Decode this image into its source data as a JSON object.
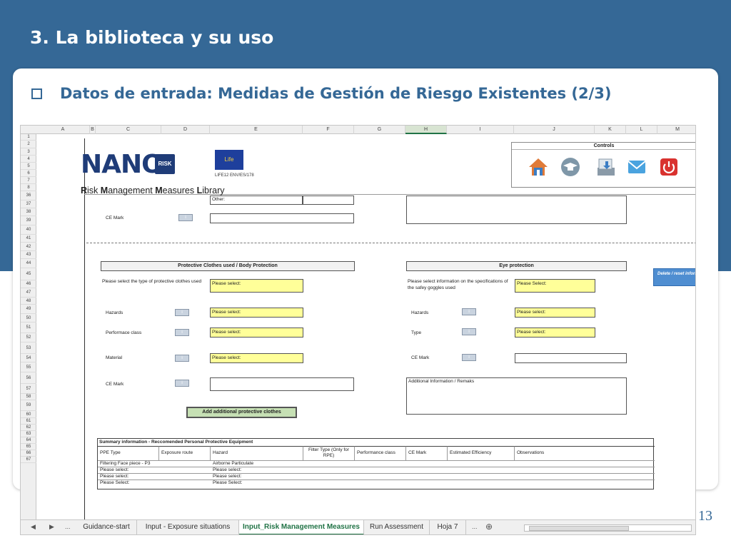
{
  "slide": {
    "title": "3. La biblioteca y su uso",
    "subtitle": "Datos de entrada: Medidas de Gestión de Riesgo Existentes (2/3)",
    "page_number": "13",
    "colors": {
      "band": "#356896",
      "accent": "#356896",
      "select_fill": "#ffff99",
      "excel_green": "#217346"
    }
  },
  "excel": {
    "columns": [
      "A",
      "B",
      "C",
      "D",
      "E",
      "F",
      "G",
      "H",
      "I",
      "J",
      "K",
      "L",
      "M"
    ],
    "active_column": "H",
    "rows": [
      "1",
      "2",
      "3",
      "4",
      "5",
      "6",
      "7",
      "8",
      "36",
      "37",
      "38",
      "39",
      "40",
      "41",
      "42",
      "43",
      "44",
      "45",
      "46",
      "47",
      "48",
      "49",
      "50",
      "51",
      "52",
      "53",
      "54",
      "55",
      "56",
      "57",
      "58",
      "59",
      "60",
      "61",
      "62",
      "63",
      "64",
      "65",
      "66",
      "67"
    ],
    "header": {
      "logo_text": "NANO",
      "logo_badge": "RISK",
      "eu_flag": "Life",
      "eu_code": "LIFE12 ENV/ES/178",
      "library_title_parts": [
        "R",
        "isk ",
        "M",
        "anagement ",
        "M",
        "easures ",
        "L",
        "ibrary"
      ]
    },
    "controls": {
      "title": "Controls",
      "buttons": [
        "home-icon",
        "guide-icon",
        "download-icon",
        "mail-icon",
        "power-icon"
      ]
    },
    "top_section": {
      "other_label": "Other:",
      "ce_mark_label": "CE Mark"
    },
    "protective_clothes": {
      "title": "Protective Clothes  used / Body Protection",
      "type_label": "Please select the type of protective clothes used",
      "type_value": "Please select:",
      "hazards_label": "Hazards",
      "hazards_value": "Please select:",
      "performance_label": "Performace class",
      "performance_value": "Please select:",
      "material_label": "Material",
      "material_value": "Please select:",
      "ce_mark_label": "CE Mark",
      "add_button": "Add additional protective clothes"
    },
    "eye_protection": {
      "title": "Eye protection",
      "spec_label": "Please select information on the specifications of the safey goggles used",
      "spec_value": "Please Select:",
      "hazards_label": "Hazards",
      "hazards_value": "Please select:",
      "type_label": "Type",
      "type_value": "Please select:",
      "ce_mark_label": "CE Mark",
      "remarks_label": "Additional Information / Remaks"
    },
    "info_button": "i",
    "delete_button": "Delete / reset information",
    "summary": {
      "title": "Summary information - Reccomended Personal Protective Equipment",
      "headers": [
        "PPE Type",
        "Exposure route",
        "Hazard",
        "Filter Type (Only for RPE)",
        "Performance class",
        "CE Mark",
        "Estimated Efficiency",
        "Observations"
      ],
      "rows": [
        [
          "Filtering Face piece - P3",
          "",
          "Airborne Particulate"
        ],
        [
          "Please select:",
          "",
          "Please select:"
        ],
        [
          "Please select:",
          "",
          "Please select:"
        ],
        [
          "Please Select:",
          "",
          "Please Select:"
        ]
      ]
    },
    "tabs": [
      "Guidance-start",
      "Input - Exposure situations",
      "Input_Risk Management Measures",
      "Run Assessment",
      "Hoja 7"
    ],
    "active_tab": "Input_Risk Management Measures",
    "tab_ellipsis": "...",
    "add_sheet": "⊕"
  }
}
